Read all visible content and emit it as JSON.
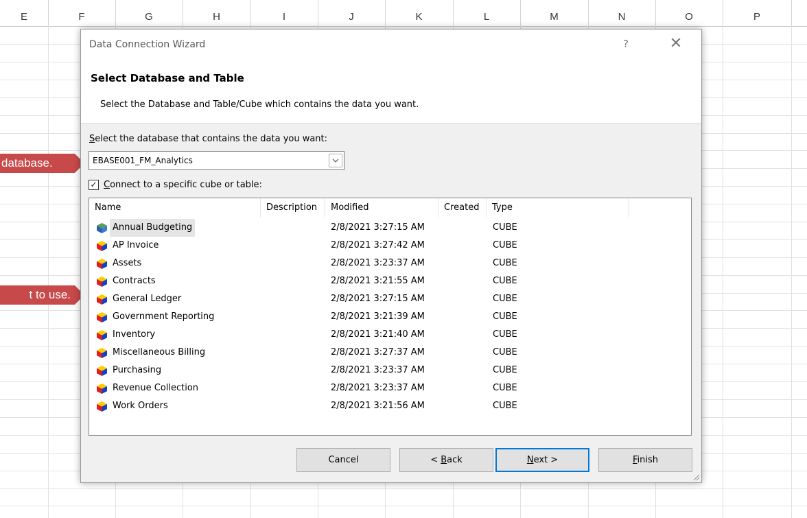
{
  "sheet": {
    "columns": [
      "E",
      "F",
      "G",
      "H",
      "I",
      "J",
      "K",
      "L",
      "M",
      "N",
      "O",
      "P"
    ]
  },
  "callouts": {
    "db": "database.",
    "table": "t to use."
  },
  "dialog": {
    "title": "Data Connection Wizard",
    "help": "?",
    "close": "✕",
    "heading": "Select Database and Table",
    "subheading": "Select the Database and Table/Cube which contains the data you want.",
    "db_label_prefix": "S",
    "db_label_rest": "elect the database that contains the data you want:",
    "db_value": "EBASE001_FM_Analytics",
    "db_arrow": "⌄",
    "checkbox_checked": "✓",
    "checkbox_label_prefix": "C",
    "checkbox_label_rest": "onnect to a specific cube or table:",
    "list_headers": {
      "name": "Name",
      "description": "Description",
      "modified": "Modified",
      "created": "Created",
      "type": "Type"
    },
    "rows": [
      {
        "name": "Annual Budgeting",
        "modified": "2/8/2021 3:27:15 AM",
        "type": "CUBE",
        "icon": "cube-icon-blue"
      },
      {
        "name": "AP Invoice",
        "modified": "2/8/2021 3:27:42 AM",
        "type": "CUBE",
        "icon": "cube-icon"
      },
      {
        "name": "Assets",
        "modified": "2/8/2021 3:23:37 AM",
        "type": "CUBE",
        "icon": "cube-icon"
      },
      {
        "name": "Contracts",
        "modified": "2/8/2021 3:21:55 AM",
        "type": "CUBE",
        "icon": "cube-icon"
      },
      {
        "name": "General Ledger",
        "modified": "2/8/2021 3:27:15 AM",
        "type": "CUBE",
        "icon": "cube-icon"
      },
      {
        "name": "Government Reporting",
        "modified": "2/8/2021 3:21:39 AM",
        "type": "CUBE",
        "icon": "cube-icon"
      },
      {
        "name": "Inventory",
        "modified": "2/8/2021 3:21:40 AM",
        "type": "CUBE",
        "icon": "cube-icon"
      },
      {
        "name": "Miscellaneous Billing",
        "modified": "2/8/2021 3:27:37 AM",
        "type": "CUBE",
        "icon": "cube-icon"
      },
      {
        "name": "Purchasing",
        "modified": "2/8/2021 3:23:37 AM",
        "type": "CUBE",
        "icon": "cube-icon"
      },
      {
        "name": "Revenue Collection",
        "modified": "2/8/2021 3:23:37 AM",
        "type": "CUBE",
        "icon": "cube-icon"
      },
      {
        "name": "Work Orders",
        "modified": "2/8/2021 3:21:56 AM",
        "type": "CUBE",
        "icon": "cube-icon"
      }
    ],
    "buttons": {
      "cancel": "Cancel",
      "back_prefix": "< ",
      "back_key": "B",
      "back_rest": "ack",
      "next_key": "N",
      "next_rest": "ext >",
      "finish_key": "F",
      "finish_rest": "inish"
    }
  },
  "colors": {
    "callout": "#c7494a",
    "accent": "#0078d7",
    "dialog_bg": "#f0f0f0"
  }
}
